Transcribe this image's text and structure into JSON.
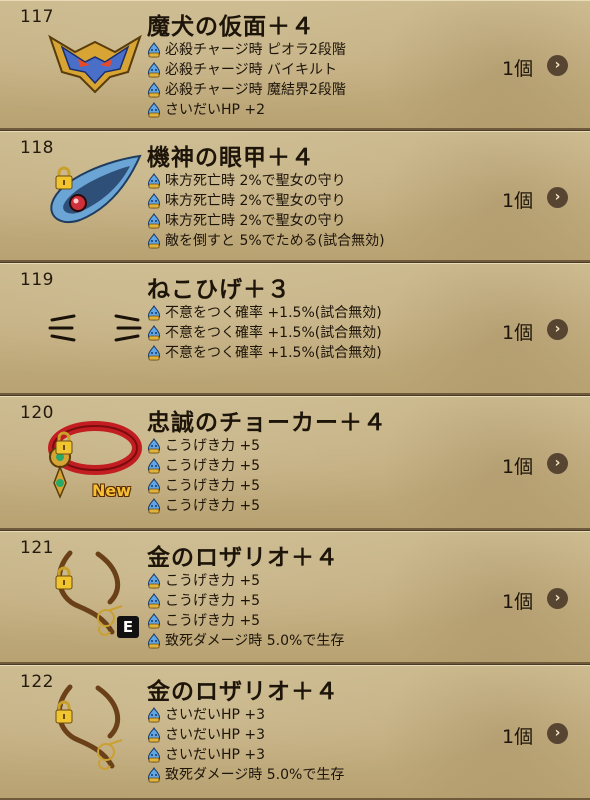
{
  "items": [
    {
      "number": "117",
      "name": "魔犬の仮面＋４",
      "quantity": "1個",
      "locked": false,
      "icon": "dog-mask-icon",
      "effects": [
        "必殺チャージ時 ピオラ2段階",
        "必殺チャージ時 バイキルト",
        "必殺チャージ時 魔結界2段階",
        "さいだいHP +2"
      ]
    },
    {
      "number": "118",
      "name": "機神の眼甲＋４",
      "quantity": "1個",
      "locked": true,
      "icon": "machine-eye-icon",
      "effects": [
        "味方死亡時 2%で聖女の守り",
        "味方死亡時 2%で聖女の守り",
        "味方死亡時 2%で聖女の守り",
        "敵を倒すと 5%でためる(試合無効)"
      ]
    },
    {
      "number": "119",
      "name": "ねこひげ＋３",
      "quantity": "1個",
      "locked": false,
      "icon": "cat-whiskers-icon",
      "effects": [
        "不意をつく確率 +1.5%(試合無効)",
        "不意をつく確率 +1.5%(試合無効)",
        "不意をつく確率 +1.5%(試合無効)"
      ]
    },
    {
      "number": "120",
      "name": "忠誠のチョーカー＋４",
      "quantity": "1個",
      "locked": true,
      "icon": "red-choker-icon",
      "badge": "New",
      "effects": [
        "こうげき力 +5",
        "こうげき力 +5",
        "こうげき力 +5",
        "こうげき力 +5"
      ]
    },
    {
      "number": "121",
      "name": "金のロザリオ＋４",
      "quantity": "1個",
      "locked": true,
      "icon": "gold-rosary-icon",
      "badge": "E",
      "effects": [
        "こうげき力 +5",
        "こうげき力 +5",
        "こうげき力 +5",
        "致死ダメージ時 5.0%で生存"
      ]
    },
    {
      "number": "122",
      "name": "金のロザリオ＋４",
      "quantity": "1個",
      "locked": true,
      "icon": "gold-rosary-icon",
      "effects": [
        "さいだいHP +3",
        "さいだいHP +3",
        "さいだいHP +3",
        "致死ダメージ時 5.0%で生存"
      ]
    }
  ],
  "arrow_glyph": "›",
  "effect_bullet_icon": "slime-bullet-icon",
  "colors": {
    "accent_red": "#7a0f12",
    "row_bg": "#c3ae80",
    "text": "#1e150a"
  }
}
